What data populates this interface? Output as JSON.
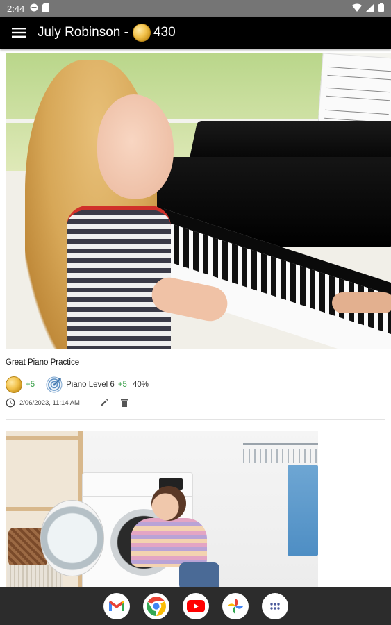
{
  "status_bar": {
    "time": "2:44"
  },
  "app_bar": {
    "title": "July Robinson -",
    "score": "430"
  },
  "feed": [
    {
      "title": "Great Piano Practice",
      "coins": "+5",
      "skill": "Piano Level 6",
      "skill_points": "+5",
      "progress": "40%",
      "timestamp": "2/06/2023, 11:14 AM"
    }
  ],
  "nav_apps": [
    "gmail-icon",
    "chrome-icon",
    "youtube-icon",
    "photos-icon",
    "app-drawer-icon"
  ],
  "colors": {
    "status_bar_bg": "#757575",
    "app_bar_bg": "#000000",
    "points_green": "#3aa04a",
    "nav_bar_bg": "#2c2c2c"
  }
}
